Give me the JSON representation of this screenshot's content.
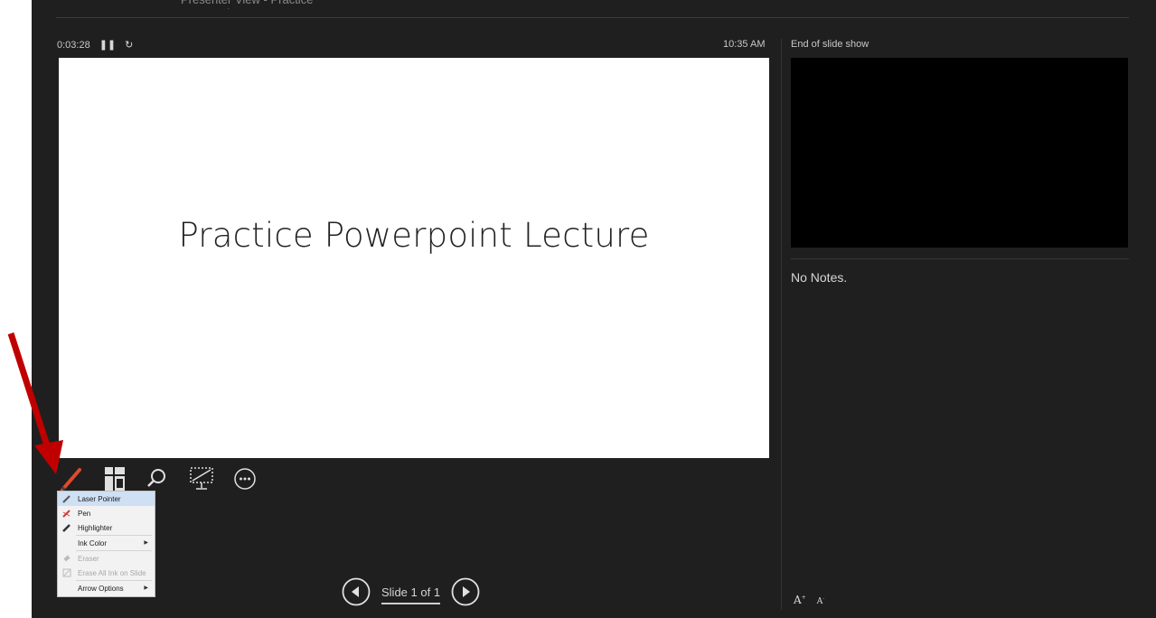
{
  "window": {
    "top_text": "Presenter View - Practice Powerpoint"
  },
  "presenter": {
    "elapsed": "0:03:28",
    "clock": "10:35 AM",
    "next_slide_label": "End of slide show",
    "notes_text": "No Notes."
  },
  "slide": {
    "title": "Practice Powerpoint Lecture"
  },
  "toolbar": {
    "tools": [
      "pen-tool-icon",
      "see-all-slides-icon",
      "zoom-icon",
      "black-screen-icon",
      "more-options-icon"
    ]
  },
  "pen_menu": {
    "items": [
      {
        "label": "Laser Pointer",
        "icon": "laser-pointer-icon",
        "selected": true
      },
      {
        "label": "Pen",
        "icon": "pen-icon"
      },
      {
        "label": "Highlighter",
        "icon": "highlighter-icon"
      },
      {
        "label": "Ink Color",
        "submenu": true
      },
      {
        "label": "Eraser",
        "icon": "eraser-icon",
        "disabled": true
      },
      {
        "label": "Erase All Ink on Slide",
        "icon": "erase-all-icon",
        "disabled": true
      },
      {
        "label": "Arrow Options",
        "submenu": true
      }
    ]
  },
  "navigation": {
    "counter": "Slide 1 of 1"
  },
  "colors": {
    "background": "#1f1f1f",
    "annotation_arrow": "#c00000",
    "pen_tool_accent": "#e04a2a",
    "menu_selection": "#cfe0f5"
  }
}
